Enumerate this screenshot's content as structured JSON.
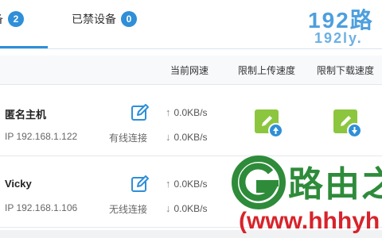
{
  "tabs": [
    {
      "label": "备",
      "count": "2"
    },
    {
      "label": "已禁设备",
      "count": "0"
    }
  ],
  "table": {
    "headers": {
      "current_speed": "当前网速",
      "limit_upload": "限制上传速度",
      "limit_download": "限制下载速度"
    },
    "rows": [
      {
        "name": "匿名主机",
        "ip": "IP 192.168.1.122",
        "connection": "有线连接",
        "upload": "0.0KB/s",
        "download": "0.0KB/s"
      },
      {
        "name": "Vicky",
        "ip": "IP 192.168.1.106",
        "connection": "无线连接",
        "upload": "0.0KB/s",
        "download": "0.0KB/s"
      }
    ]
  },
  "watermark": {
    "top_big": "192路",
    "top_small": "192ly.",
    "brand_cn": "路由之",
    "url": "(www.hhhyh"
  },
  "icons": {
    "edit": "edit-icon",
    "arrow_up": "↑",
    "arrow_down": "↓",
    "limit": "limit-speed-icon"
  },
  "colors": {
    "accent": "#2f8fd8",
    "limit_button": "#8cc63f",
    "watermark_green": "#2e8b3a",
    "watermark_red": "#d8232a"
  }
}
